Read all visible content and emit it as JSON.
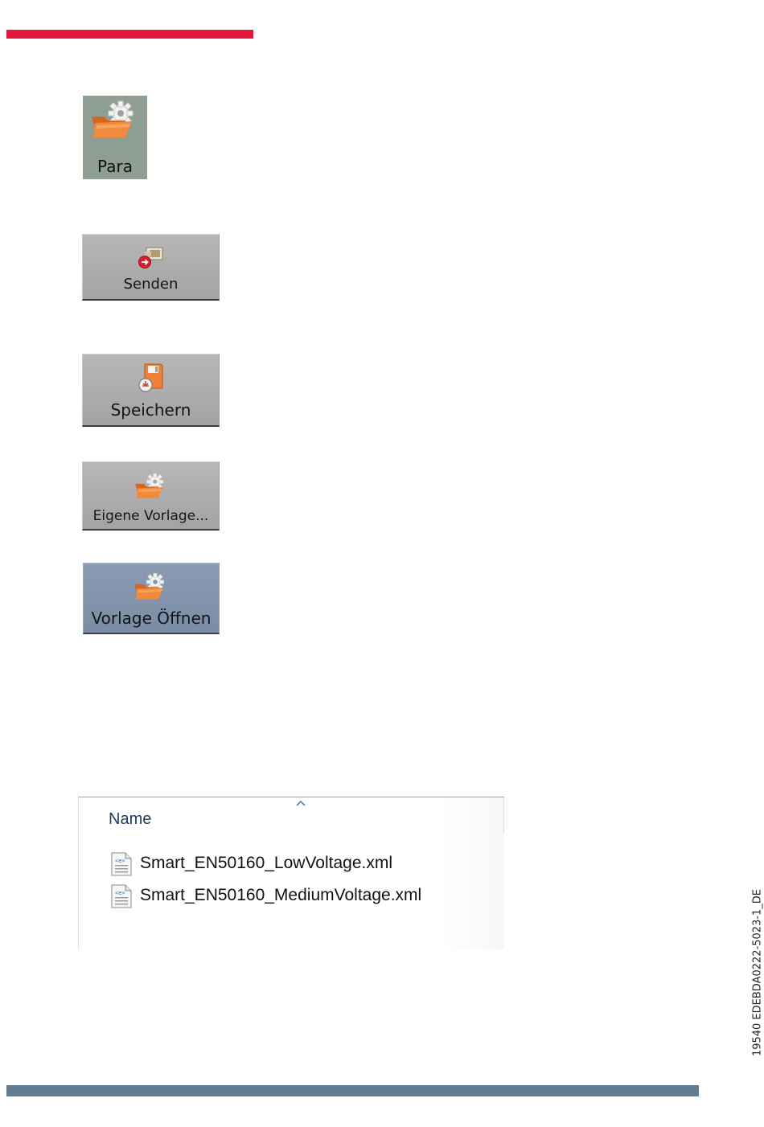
{
  "buttons": {
    "para": "Para",
    "senden": "Senden",
    "speichern": "Speichern",
    "eigene_vorlage": "Eigene Vorlage...",
    "vorlage_oeffnen": "Vorlage Öffnen"
  },
  "icons": {
    "para": "folder-gear-icon",
    "senden": "send-icon",
    "speichern": "save-icon",
    "eigene_vorlage": "folder-gear-icon",
    "vorlage_oeffnen": "folder-gear-icon",
    "sort": "sort-ascending-icon",
    "file": "xml-file-icon"
  },
  "file_list": {
    "column_header": "Name",
    "files": [
      {
        "name": "Smart_EN50160_LowVoltage.xml"
      },
      {
        "name": "Smart_EN50160_MediumVoltage.xml"
      }
    ]
  },
  "document_id": "19540 EDEBDA0222-5023-1_DE",
  "colors": {
    "accent_red": "#e4173c",
    "footer_bar": "#627d92",
    "folder_orange": "#f08a3c"
  }
}
